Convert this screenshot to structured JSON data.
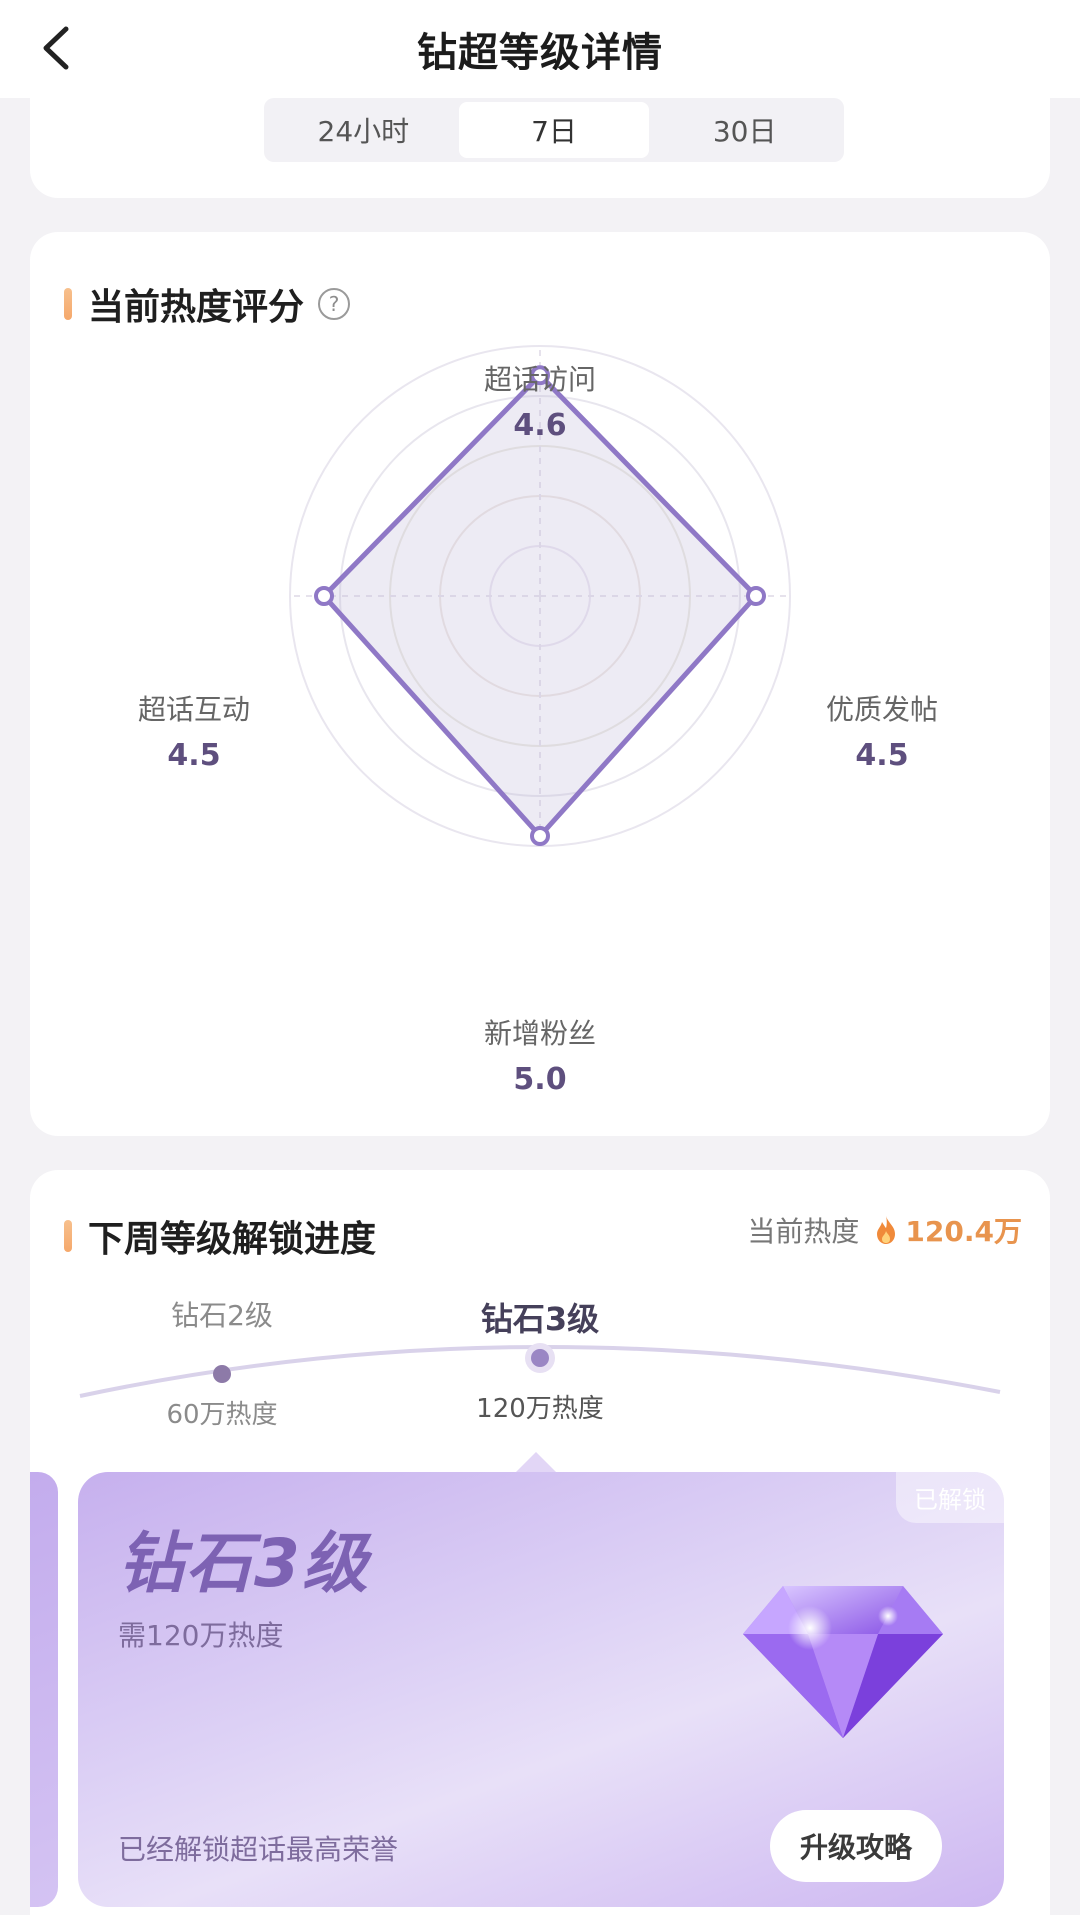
{
  "header": {
    "title": "钻超等级详情"
  },
  "tabs": [
    {
      "label": "24小时",
      "active": false
    },
    {
      "label": "7日",
      "active": true
    },
    {
      "label": "30日",
      "active": false
    }
  ],
  "radar": {
    "title": "当前热度评分",
    "help_glyph": "?",
    "axes": [
      {
        "name": "超话访问",
        "value": "4.6"
      },
      {
        "name": "优质发帖",
        "value": "4.5"
      },
      {
        "name": "新增粉丝",
        "value": "5.0"
      },
      {
        "name": "超话互动",
        "value": "4.5"
      }
    ]
  },
  "chart_data": {
    "type": "radar",
    "categories": [
      "超话访问",
      "优质发帖",
      "新增粉丝",
      "超话互动"
    ],
    "series": [
      {
        "values": [
          4.6,
          4.5,
          5.0,
          4.5
        ]
      }
    ],
    "rlim": [
      0,
      5.0
    ],
    "grid": true
  },
  "progress": {
    "title": "下周等级解锁进度",
    "current_heat_label": "当前热度",
    "current_heat_value": "120.4万",
    "levels": [
      {
        "name": "钻石2级",
        "heat": "60万热度"
      },
      {
        "name": "钻石3级",
        "heat": "120万热度"
      }
    ],
    "card": {
      "badge": "已解锁",
      "name": "钻石3级",
      "requirement": "需120万热度",
      "honor": "已经解锁超话最高荣誉",
      "button": "升级攻略"
    }
  },
  "colors": {
    "accent": "#8b6fc9",
    "heat": "#e8944e"
  }
}
